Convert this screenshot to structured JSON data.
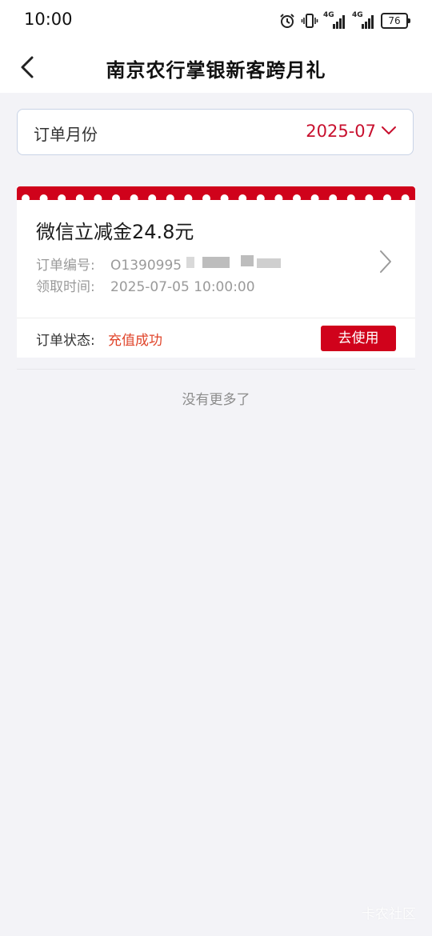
{
  "status_bar": {
    "time": "10:00",
    "network_label_1": "4G",
    "network_label_2": "4G",
    "battery": "76"
  },
  "nav": {
    "title": "南京农行掌银新客跨月礼"
  },
  "filter": {
    "label": "订单月份",
    "value": "2025-07"
  },
  "order": {
    "title": "微信立减金24.8元",
    "order_no_label": "订单编号:",
    "order_no_value": "O1390995",
    "claim_time_label": "领取时间:",
    "claim_time_value": "2025-07-05 10:00:00",
    "status_label": "订单状态:",
    "status_value": "充值成功",
    "action_label": "去使用"
  },
  "list_footer": "没有更多了",
  "watermark": "卡农社区",
  "colors": {
    "brand_red": "#d0021b",
    "month_red": "#c8102e",
    "status_red": "#e0452b",
    "page_bg": "#f3f3f7"
  },
  "icons": {
    "back": "chevron-left-icon",
    "month_dropdown": "chevron-down-icon",
    "card_arrow": "chevron-right-icon",
    "alarm": "alarm-clock-icon",
    "vibrate": "vibrate-icon",
    "signal": "cell-signal-icon"
  }
}
